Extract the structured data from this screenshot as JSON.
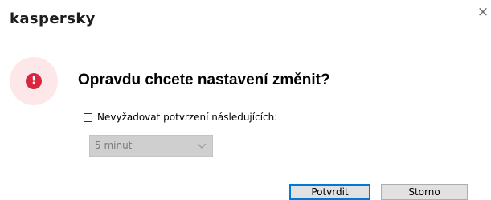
{
  "window": {
    "brand": "kaspersky",
    "close_glyph": "×"
  },
  "alert": {
    "icon": "exclamation-icon",
    "glyph": "!",
    "color": "#d7263d",
    "halo_color": "#fde7e9"
  },
  "dialog": {
    "question": "Opravdu chcete nastavení změnit?",
    "checkbox_label": "Nevyžadovat potvrzení následujících:",
    "checkbox_checked": false,
    "select_value": "5 minut",
    "select_disabled": true
  },
  "buttons": {
    "confirm_label": "Potvrdit",
    "cancel_label": "Storno"
  }
}
